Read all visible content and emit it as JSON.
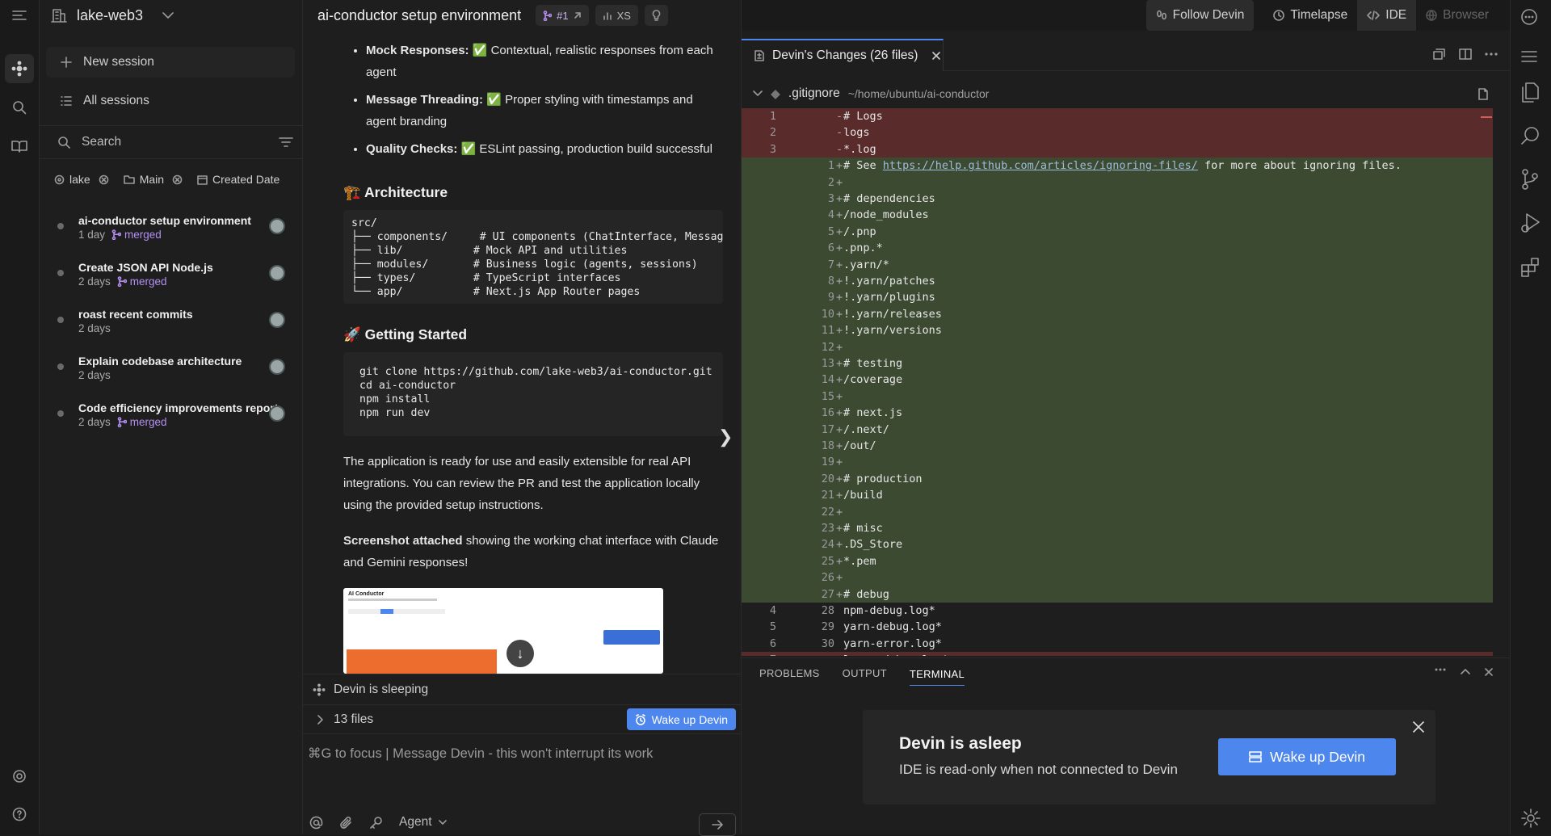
{
  "workspace": {
    "name": "lake-web3"
  },
  "sidebar": {
    "new_session": "New session",
    "all_sessions": "All sessions",
    "search_placeholder": "Search",
    "filters": [
      {
        "label": "lake"
      },
      {
        "label": "Main"
      },
      {
        "label": "Created Date"
      }
    ],
    "sessions": [
      {
        "title": "ai-conductor setup environment",
        "age": "1 day",
        "status": "merged"
      },
      {
        "title": "Create JSON API Node.js",
        "age": "2 days",
        "status": "merged"
      },
      {
        "title": "roast recent commits",
        "age": "2 days",
        "status": ""
      },
      {
        "title": "Explain codebase architecture",
        "age": "2 days",
        "status": ""
      },
      {
        "title": "Code efficiency improvements report",
        "age": "2 days",
        "status": "merged"
      }
    ]
  },
  "chat": {
    "title": "ai-conductor setup environment",
    "pr_label": "#1",
    "size_label": "XS",
    "bullets": [
      {
        "bold": "Mock Responses:",
        "check": "✅",
        "text": " Contextual, realistic responses from each agent"
      },
      {
        "bold": "Message Threading:",
        "check": "✅",
        "text": " Proper styling with timestamps and agent branding"
      },
      {
        "bold": "Quality Checks:",
        "check": "✅",
        "text": " ESLint passing, production build successful"
      }
    ],
    "arch_heading": "🏗️ Architecture",
    "arch_code": "src/\n├── components/     # UI components (ChatInterface, MessageBubble)\n├── lib/           # Mock API and utilities\n├── modules/       # Business logic (agents, sessions)\n├── types/         # TypeScript interfaces\n└── app/           # Next.js App Router pages",
    "start_heading": "🚀 Getting Started",
    "start_code": "git clone https://github.com/lake-web3/ai-conductor.git\ncd ai-conductor\nnpm install\nnpm run dev",
    "para1": "The application is ready for use and easily extensible for real API integrations. You can review the PR and test the application locally using the provided setup instructions.",
    "para2_bold": "Screenshot attached",
    "para2_rest": " showing the working chat interface with Claude and Gemini responses!",
    "thumb_title": "AI Conductor",
    "status": "Devin is sleeping",
    "files_count": "13 files",
    "wake_button": "Wake up Devin",
    "composer_placeholder": "⌘G to focus | Message Devin - this won't interrupt its work",
    "mode": "Agent"
  },
  "ide_top": {
    "follow": "Follow Devin",
    "timelapse": "Timelapse",
    "ide": "IDE",
    "browser": "Browser"
  },
  "editor": {
    "tab_label": "Devin's Changes (26 files)",
    "file_name": ".gitignore",
    "file_path": "~/home/ubuntu/ai-conductor",
    "lines": [
      {
        "o": "1",
        "n": "",
        "k": "del",
        "s": "-",
        "t": "# Logs",
        "c": true
      },
      {
        "o": "2",
        "n": "",
        "k": "del",
        "s": "-",
        "t": "logs"
      },
      {
        "o": "3",
        "n": "",
        "k": "del",
        "s": "-",
        "t": "*.log"
      },
      {
        "o": "",
        "n": "1",
        "k": "add",
        "s": "+",
        "t": "# See ",
        "link": "https://help.github.com/articles/ignoring-files/",
        "after": " for more about ignoring files.",
        "c": true
      },
      {
        "o": "",
        "n": "2",
        "k": "add",
        "s": "+",
        "t": ""
      },
      {
        "o": "",
        "n": "3",
        "k": "add",
        "s": "+",
        "t": "# dependencies",
        "c": true
      },
      {
        "o": "",
        "n": "4",
        "k": "add",
        "s": "+",
        "t": "/node_modules"
      },
      {
        "o": "",
        "n": "5",
        "k": "add",
        "s": "+",
        "t": "/.pnp"
      },
      {
        "o": "",
        "n": "6",
        "k": "add",
        "s": "+",
        "t": ".pnp.*"
      },
      {
        "o": "",
        "n": "7",
        "k": "add",
        "s": "+",
        "t": ".yarn/*"
      },
      {
        "o": "",
        "n": "8",
        "k": "add",
        "s": "+",
        "t": "!.yarn/patches"
      },
      {
        "o": "",
        "n": "9",
        "k": "add",
        "s": "+",
        "t": "!.yarn/plugins"
      },
      {
        "o": "",
        "n": "10",
        "k": "add",
        "s": "+",
        "t": "!.yarn/releases"
      },
      {
        "o": "",
        "n": "11",
        "k": "add",
        "s": "+",
        "t": "!.yarn/versions"
      },
      {
        "o": "",
        "n": "12",
        "k": "add",
        "s": "+",
        "t": ""
      },
      {
        "o": "",
        "n": "13",
        "k": "add",
        "s": "+",
        "t": "# testing",
        "c": true
      },
      {
        "o": "",
        "n": "14",
        "k": "add",
        "s": "+",
        "t": "/coverage"
      },
      {
        "o": "",
        "n": "15",
        "k": "add",
        "s": "+",
        "t": ""
      },
      {
        "o": "",
        "n": "16",
        "k": "add",
        "s": "+",
        "t": "# next.js",
        "c": true
      },
      {
        "o": "",
        "n": "17",
        "k": "add",
        "s": "+",
        "t": "/.next/"
      },
      {
        "o": "",
        "n": "18",
        "k": "add",
        "s": "+",
        "t": "/out/"
      },
      {
        "o": "",
        "n": "19",
        "k": "add",
        "s": "+",
        "t": ""
      },
      {
        "o": "",
        "n": "20",
        "k": "add",
        "s": "+",
        "t": "# production",
        "c": true
      },
      {
        "o": "",
        "n": "21",
        "k": "add",
        "s": "+",
        "t": "/build"
      },
      {
        "o": "",
        "n": "22",
        "k": "add",
        "s": "+",
        "t": ""
      },
      {
        "o": "",
        "n": "23",
        "k": "add",
        "s": "+",
        "t": "# misc",
        "c": true
      },
      {
        "o": "",
        "n": "24",
        "k": "add",
        "s": "+",
        "t": ".DS_Store"
      },
      {
        "o": "",
        "n": "25",
        "k": "add",
        "s": "+",
        "t": "*.pem"
      },
      {
        "o": "",
        "n": "26",
        "k": "add",
        "s": "+",
        "t": ""
      },
      {
        "o": "",
        "n": "27",
        "k": "add",
        "s": "+",
        "t": "# debug",
        "c": true
      },
      {
        "o": "4",
        "n": "28",
        "k": "",
        "s": " ",
        "t": "npm-debug.log*"
      },
      {
        "o": "5",
        "n": "29",
        "k": "",
        "s": " ",
        "t": "yarn-debug.log*"
      },
      {
        "o": "6",
        "n": "30",
        "k": "",
        "s": " ",
        "t": "yarn-error.log*"
      },
      {
        "o": "7",
        "n": "",
        "k": "del",
        "s": "-",
        "t": "lerna-debug.log*"
      }
    ]
  },
  "panel": {
    "tabs": [
      "PROBLEMS",
      "OUTPUT",
      "TERMINAL"
    ],
    "active": "TERMINAL"
  },
  "asleep": {
    "title": "Devin is asleep",
    "subtitle": "IDE is read-only when not connected to Devin",
    "button": "Wake up Devin"
  },
  "colors": {
    "accent": "#4d86ec",
    "merged": "#b48ef2",
    "deleted_bg": "#5a2b2b",
    "added_bg": "#3d4a32"
  }
}
